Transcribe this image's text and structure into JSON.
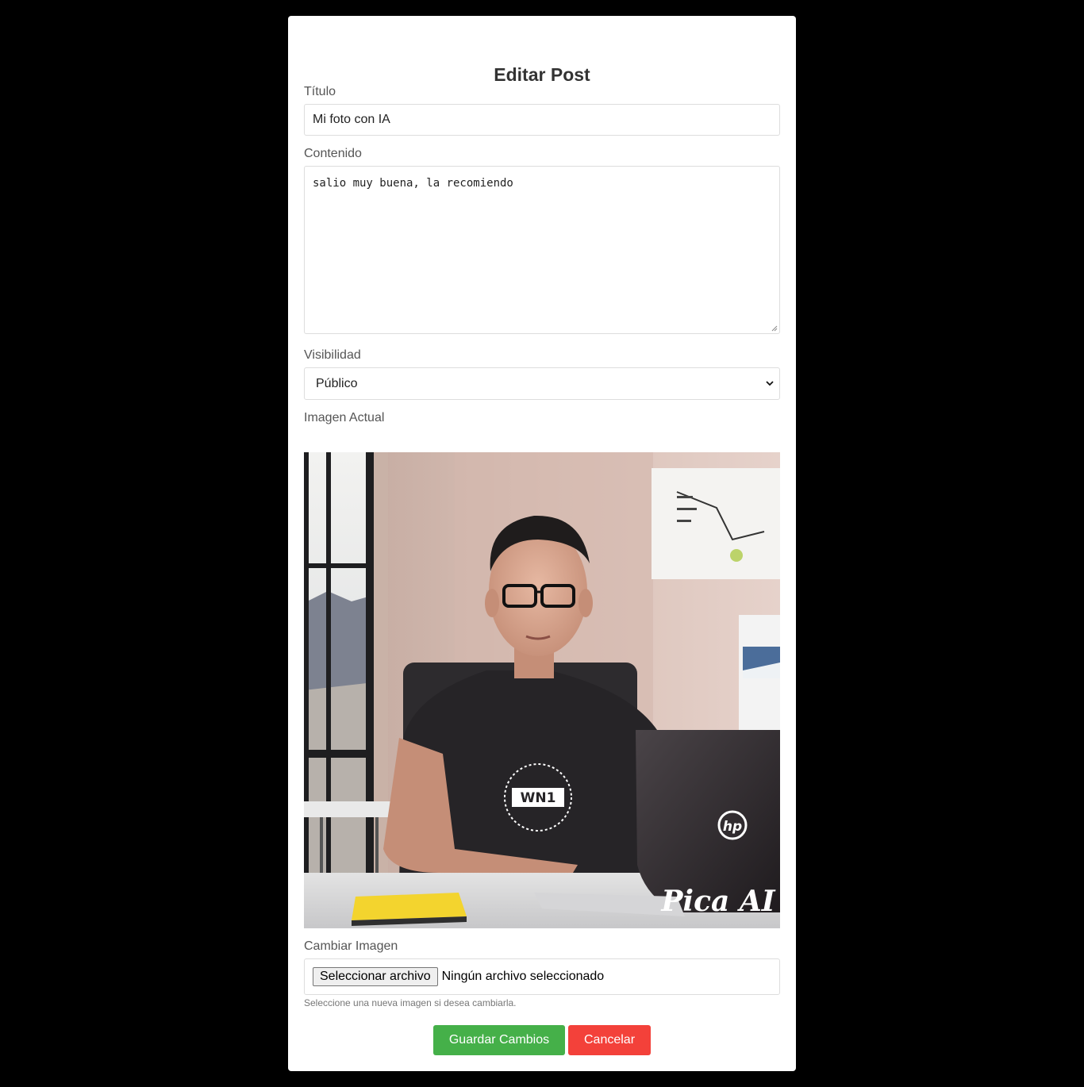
{
  "form": {
    "heading": "Editar Post",
    "title_label": "Título",
    "title_value": "Mi foto con IA",
    "content_label": "Contenido",
    "content_value": "salio muy buena, la recomiendo",
    "visibility_label": "Visibilidad",
    "visibility_value": "Público",
    "current_image_label": "Imagen Actual",
    "change_image_label": "Cambiar Imagen",
    "file_button_label": "Seleccionar archivo",
    "file_status": "Ningún archivo seleccionado",
    "file_hint": "Seleccione una nueva imagen si desea cambiarla.",
    "save_label": "Guardar Cambios",
    "cancel_label": "Cancelar"
  },
  "image": {
    "shirt_logo_text": "WN1",
    "laptop_logo_text": "hp",
    "watermark_text": "Pica AI"
  },
  "colors": {
    "background": "#000000",
    "card": "#ffffff",
    "save": "#45b049",
    "cancel": "#f3413a"
  },
  "icons": {
    "select_arrow": "chevron-down-icon",
    "textarea_resize": "resize-grip-icon"
  }
}
